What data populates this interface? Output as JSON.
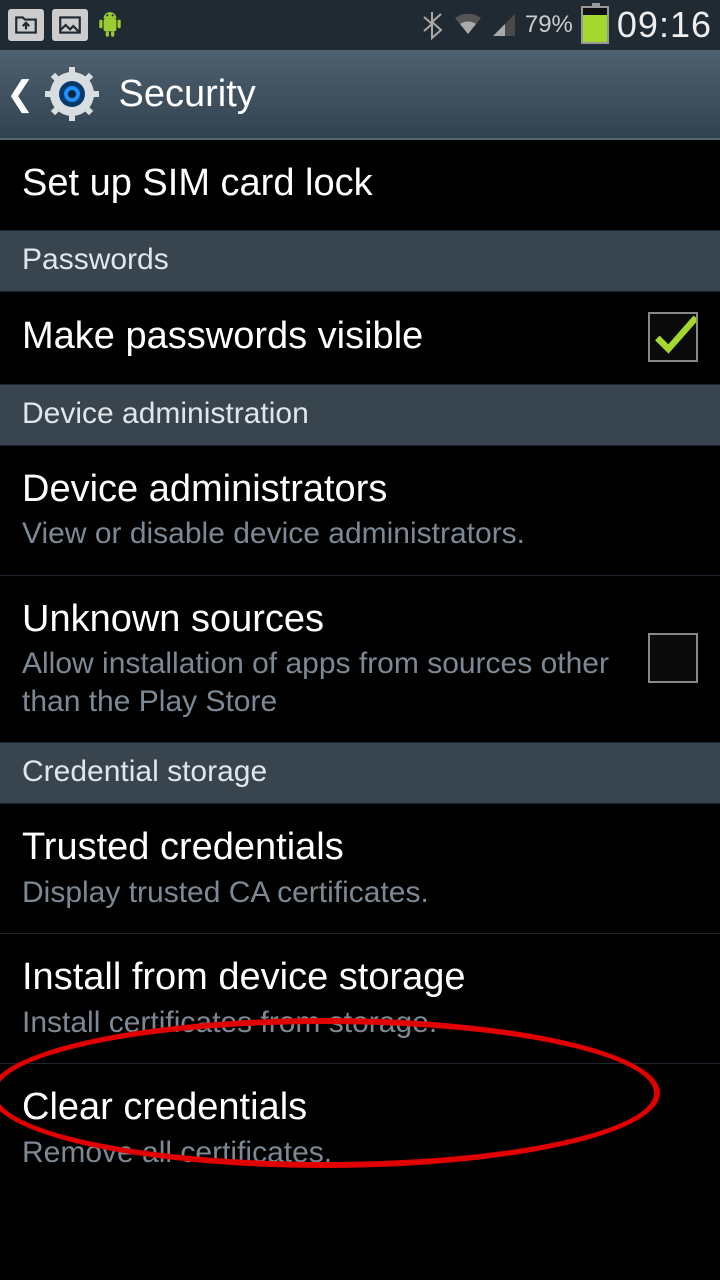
{
  "status": {
    "battery_pct": "79%",
    "time": "09:16"
  },
  "header": {
    "title": "Security"
  },
  "items": {
    "sim_lock": {
      "title": "Set up SIM card lock"
    },
    "section_passwords": "Passwords",
    "pw_visible": {
      "title": "Make passwords visible"
    },
    "section_device_admin": "Device administration",
    "device_admins": {
      "title": "Device administrators",
      "sub": "View or disable device administrators."
    },
    "unknown_sources": {
      "title": "Unknown sources",
      "sub": "Allow installation of apps from sources other than the Play Store"
    },
    "section_cred": "Credential storage",
    "trusted": {
      "title": "Trusted credentials",
      "sub": "Display trusted CA certificates."
    },
    "install": {
      "title": "Install from device storage",
      "sub": "Install certificates from storage."
    },
    "clear": {
      "title": "Clear credentials",
      "sub": "Remove all certificates."
    }
  }
}
